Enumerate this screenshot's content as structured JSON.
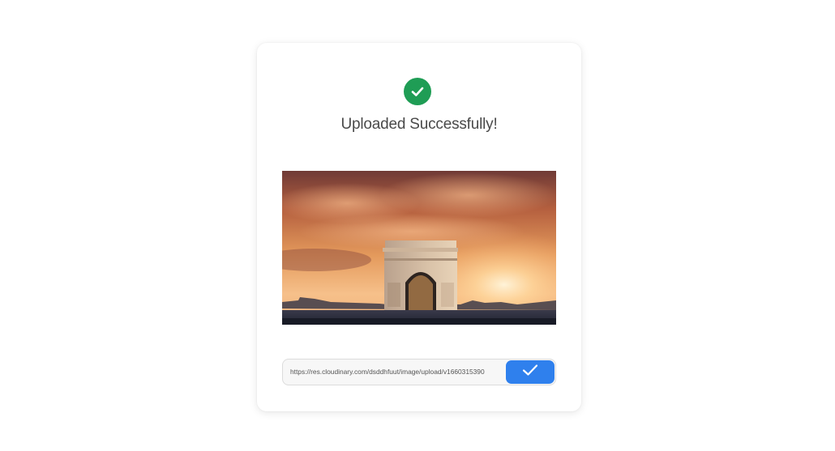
{
  "upload": {
    "title": "Uploaded Successfully!",
    "status_color": "#1f9d55",
    "status_icon": "check-circle-icon",
    "image_description_icon": "arc-de-triomphe-sunset-photo"
  },
  "url_field": {
    "value": "https://res.cloudinary.com/dsddhfuut/image/upload/v1660315390",
    "button_icon": "check-icon",
    "button_color": "#2f80ed"
  }
}
